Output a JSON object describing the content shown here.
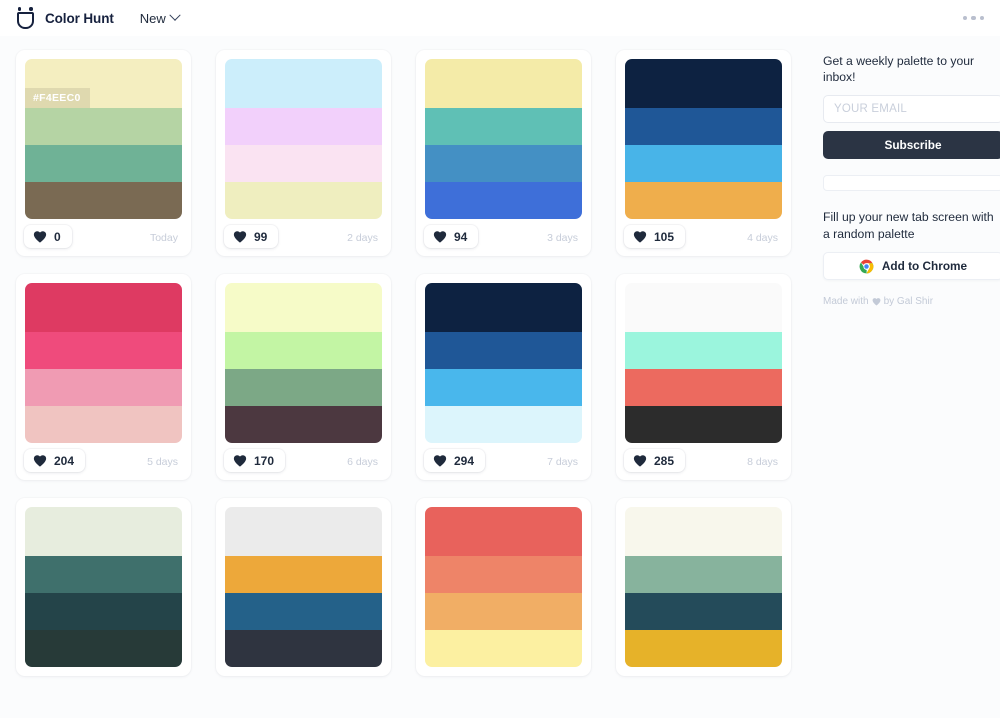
{
  "header": {
    "brand_name": "Color Hunt",
    "logo_bands": [
      "#FFD95A",
      "#FF7BAC",
      "#E84C5B"
    ],
    "nav_label": "New",
    "menu_icon": "kebab-menu-icon"
  },
  "sidebar": {
    "newsletter_title": "Get a weekly palette to your inbox!",
    "email_placeholder": "YOUR EMAIL",
    "email_value": "",
    "subscribe_label": "Subscribe",
    "extension_title": "Fill up your new tab screen with a random palette",
    "chrome_label": "Add to Chrome",
    "credit_prefix": "Made with",
    "credit_suffix": "by Gal Shir"
  },
  "palettes": [
    {
      "colors": [
        "#F4EEC0",
        "#B5D4A4",
        "#6FB296",
        "#7A6A53"
      ],
      "likes": "0",
      "age": "Today",
      "hover_hex": "#F4EEC0",
      "show_hex": true
    },
    {
      "colors": [
        "#CCEEFB",
        "#F2D0FB",
        "#FAE3F2",
        "#EFEEBF"
      ],
      "likes": "99",
      "age": "2 days",
      "hover_hex": "",
      "show_hex": false
    },
    {
      "colors": [
        "#F4EBA8",
        "#5FC0B5",
        "#4490C4",
        "#3E6FD9"
      ],
      "likes": "94",
      "age": "3 days",
      "hover_hex": "",
      "show_hex": false
    },
    {
      "colors": [
        "#0D2241",
        "#1F5797",
        "#48B4E8",
        "#EFAE4C"
      ],
      "likes": "105",
      "age": "4 days",
      "hover_hex": "",
      "show_hex": false
    },
    {
      "colors": [
        "#DE3A62",
        "#EF4B7C",
        "#F09BB3",
        "#F0C4C1"
      ],
      "likes": "204",
      "age": "5 days",
      "hover_hex": "",
      "show_hex": false
    },
    {
      "colors": [
        "#F6FBC8",
        "#C3F5A4",
        "#7CA886",
        "#4C3840"
      ],
      "likes": "170",
      "age": "6 days",
      "hover_hex": "",
      "show_hex": false
    },
    {
      "colors": [
        "#0D2241",
        "#1F5797",
        "#49B7EC",
        "#DCF5FC"
      ],
      "likes": "294",
      "age": "7 days",
      "hover_hex": "",
      "show_hex": false
    },
    {
      "colors": [
        "#FAFAFA",
        "#9BF5DD",
        "#EC6A5F",
        "#2C2C2C"
      ],
      "likes": "285",
      "age": "8 days",
      "hover_hex": "",
      "show_hex": false
    },
    {
      "colors": [
        "#E7EDDE",
        "#3F706C",
        "#244449",
        "#273A38"
      ],
      "likes": "",
      "age": "",
      "hover_hex": "",
      "show_hex": false
    },
    {
      "colors": [
        "#EBEBEB",
        "#EDA83A",
        "#246189",
        "#2F3440"
      ],
      "likes": "",
      "age": "",
      "hover_hex": "",
      "show_hex": false
    },
    {
      "colors": [
        "#E8625C",
        "#EE8468",
        "#F1AE65",
        "#FCF0A1"
      ],
      "likes": "",
      "age": "",
      "hover_hex": "",
      "show_hex": false
    },
    {
      "colors": [
        "#F8F7EC",
        "#87B39D",
        "#244B5A",
        "#E6B229"
      ],
      "likes": "",
      "age": "",
      "hover_hex": "",
      "show_hex": false
    }
  ]
}
